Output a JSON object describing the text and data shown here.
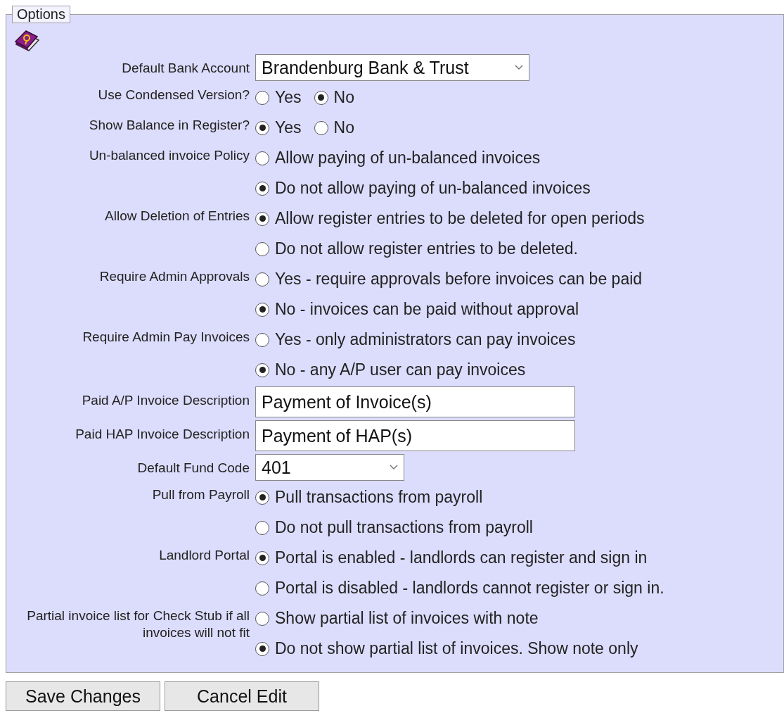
{
  "legend": "Options",
  "rows": [
    {
      "kind": "select",
      "label": "Default Bank Account",
      "value": "Brandenburg Bank & Trust"
    },
    {
      "kind": "radio-inline",
      "label": "Use Condensed Version?",
      "options": [
        {
          "text": "Yes",
          "selected": false
        },
        {
          "text": "No",
          "selected": true
        }
      ]
    },
    {
      "kind": "radio-inline",
      "label": "Show Balance in Register?",
      "options": [
        {
          "text": "Yes",
          "selected": true
        },
        {
          "text": "No",
          "selected": false
        }
      ]
    },
    {
      "kind": "radio-stack",
      "label": "Un-balanced invoice Policy",
      "options": [
        {
          "text": "Allow paying of un-balanced invoices",
          "selected": false
        },
        {
          "text": "Do not allow paying of un-balanced invoices",
          "selected": true
        }
      ]
    },
    {
      "kind": "radio-stack",
      "label": "Allow Deletion of Entries",
      "options": [
        {
          "text": "Allow register entries to be deleted for open periods",
          "selected": true
        },
        {
          "text": "Do not allow register entries to be deleted.",
          "selected": false
        }
      ]
    },
    {
      "kind": "radio-stack",
      "label": "Require Admin Approvals",
      "options": [
        {
          "text": "Yes - require approvals before invoices can be paid",
          "selected": false
        },
        {
          "text": "No - invoices can be paid without approval",
          "selected": true
        }
      ]
    },
    {
      "kind": "radio-stack",
      "label": "Require Admin Pay Invoices",
      "options": [
        {
          "text": "Yes - only administrators can pay invoices",
          "selected": false
        },
        {
          "text": "No - any A/P user can pay invoices",
          "selected": true
        }
      ]
    },
    {
      "kind": "text",
      "label": "Paid A/P Invoice Description",
      "value": "Payment of Invoice(s)"
    },
    {
      "kind": "text",
      "label": "Paid HAP Invoice Description",
      "value": "Payment of HAP(s)"
    },
    {
      "kind": "select-small",
      "label": "Default Fund Code",
      "value": "401"
    },
    {
      "kind": "radio-stack",
      "label": "Pull from Payroll",
      "options": [
        {
          "text": "Pull transactions from payroll",
          "selected": true
        },
        {
          "text": "Do not pull transactions from payroll",
          "selected": false
        }
      ]
    },
    {
      "kind": "radio-stack",
      "label": "Landlord Portal",
      "options": [
        {
          "text": "Portal is enabled - landlords can register and sign in",
          "selected": true
        },
        {
          "text": "Portal is disabled - landlords cannot register or sign in.",
          "selected": false
        }
      ]
    },
    {
      "kind": "radio-stack",
      "label": "Partial invoice list for Check Stub if all invoices will not fit",
      "options": [
        {
          "text": "Show partial list of invoices with note",
          "selected": false
        },
        {
          "text": "Do not show partial list of invoices. Show note only",
          "selected": true
        }
      ]
    }
  ],
  "buttons": [
    "Save Changes",
    "Cancel Edit"
  ]
}
